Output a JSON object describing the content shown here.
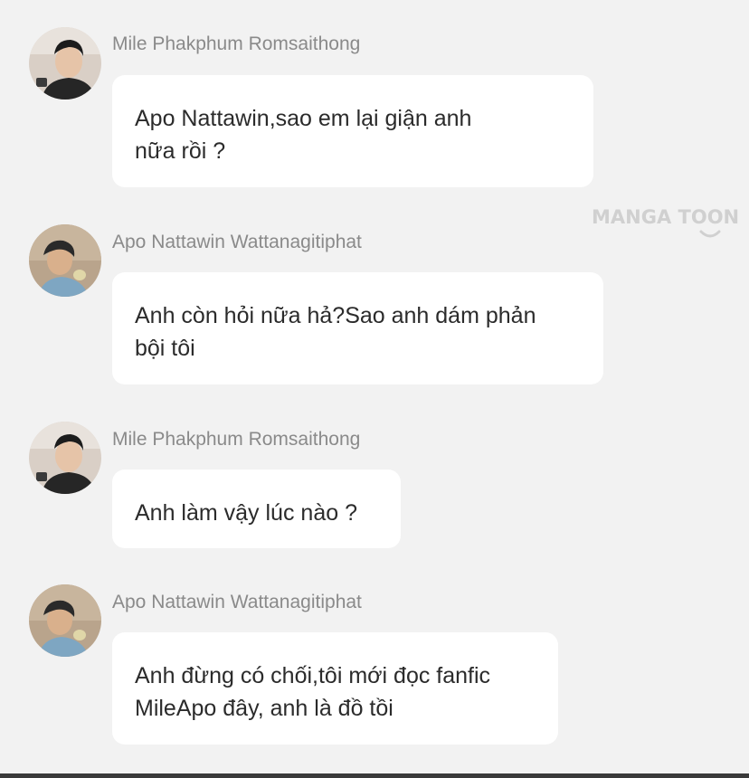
{
  "watermark": "MANGA TOON",
  "messages": [
    {
      "sender": "Mile Phakphum Romsaithong",
      "lines": [
        "Apo Nattawin,sao em lại giận anh",
        "nữa rồi ?"
      ]
    },
    {
      "sender": "Apo Nattawin Wattanagitiphat",
      "lines": [
        "Anh còn hỏi nữa hả?Sao anh dám phản",
        "bội tôi"
      ]
    },
    {
      "sender": "Mile Phakphum Romsaithong",
      "lines": [
        "Anh làm vậy lúc nào ?"
      ]
    },
    {
      "sender": "Apo Nattawin Wattanagitiphat",
      "lines": [
        "Anh đừng có chối,tôi mới đọc fanfic",
        "MileApo đây, anh là đồ tồi"
      ]
    }
  ]
}
